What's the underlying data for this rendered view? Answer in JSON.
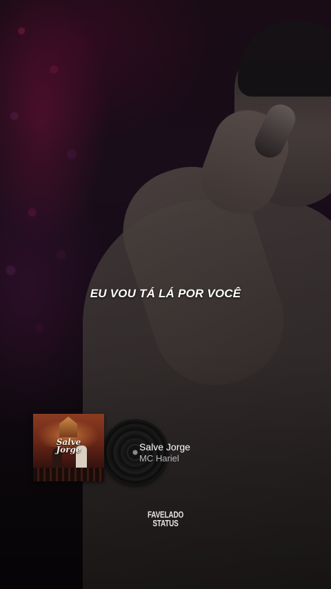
{
  "lyric": "EU VOU TÁ LÁ POR VOCÊ",
  "now_playing": {
    "album_cover_text": [
      "Salve",
      "Jorge"
    ],
    "song_title": "Salve Jorge",
    "artist": "MC Hariel"
  },
  "watermark": {
    "line1": "FAVELADO",
    "line2": "STATUS"
  },
  "colors": {
    "text_primary": "#ffffff",
    "text_secondary": "#bdb7bb",
    "background": "#0c0709"
  },
  "icons": {
    "vinyl": "vinyl-record-icon"
  }
}
